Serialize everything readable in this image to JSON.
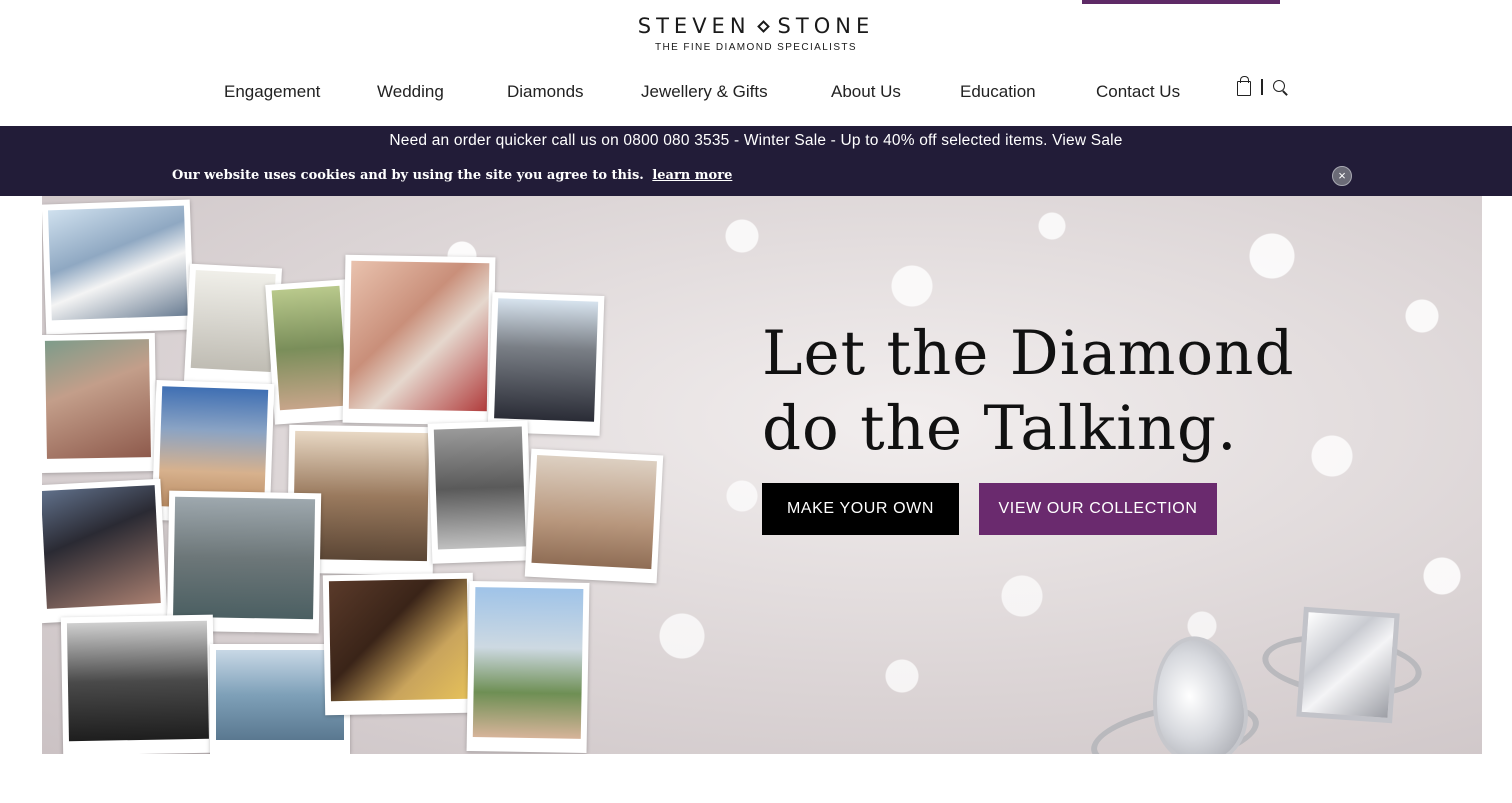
{
  "brand": {
    "name_left": "STEVEN",
    "name_right": "STONE",
    "tagline": "THE FINE DIAMOND SPECIALISTS",
    "accent_color": "#5e2a66"
  },
  "nav": {
    "items": [
      {
        "label": "Engagement"
      },
      {
        "label": "Wedding"
      },
      {
        "label": "Diamonds"
      },
      {
        "label": "Jewellery & Gifts"
      },
      {
        "label": "About Us"
      },
      {
        "label": "Education"
      },
      {
        "label": "Contact Us"
      }
    ],
    "icons": [
      "bag-icon",
      "search-icon"
    ]
  },
  "notice": {
    "promo": "Need an order quicker call us on 0800 080 3535 - Winter Sale - Up to 40% off selected items. View Sale",
    "cookie_text": "Our website uses cookies and by using the site you agree to this.",
    "cookie_link": "learn more",
    "close_symbol": "×",
    "bg_color": "#221c38"
  },
  "hero": {
    "headline_line1": "Let the Diamond",
    "headline_line2": "do the Talking.",
    "primary_button": "MAKE YOUR OWN",
    "secondary_button": "VIEW OUR COLLECTION",
    "secondary_color": "#6a2a6e"
  }
}
